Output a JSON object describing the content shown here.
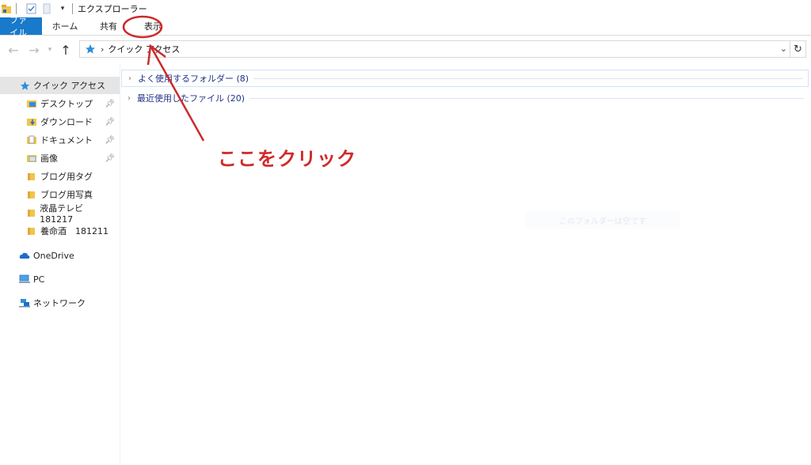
{
  "window": {
    "title": "エクスプローラー"
  },
  "ribbon": {
    "tabs": [
      "ファイル",
      "ホーム",
      "共有",
      "表示"
    ]
  },
  "address": {
    "path": "クイック アクセス",
    "icon": "star-icon"
  },
  "nav_pane": {
    "quick_access": "クイック アクセス",
    "items": [
      {
        "label": "デスクトップ",
        "icon": "desktop-folder-icon",
        "pinned": true
      },
      {
        "label": "ダウンロード",
        "icon": "download-folder-icon",
        "pinned": true
      },
      {
        "label": "ドキュメント",
        "icon": "document-folder-icon",
        "pinned": true
      },
      {
        "label": "画像",
        "icon": "pictures-folder-icon",
        "pinned": true
      },
      {
        "label": "ブログ用タグ",
        "icon": "folder-icon",
        "pinned": false
      },
      {
        "label": "ブログ用写真",
        "icon": "folder-icon",
        "pinned": false
      },
      {
        "label": "液晶テレビ　181217",
        "icon": "folder-icon",
        "pinned": false
      },
      {
        "label": "養命酒　181211",
        "icon": "folder-icon",
        "pinned": false
      }
    ],
    "onedrive": "OneDrive",
    "pc": "PC",
    "network": "ネットワーク"
  },
  "content": {
    "groups": [
      {
        "label": "よく使用するフォルダー (8)"
      },
      {
        "label": "最近使用したファイル (20)"
      }
    ],
    "empty_note": "このフォルダーは空です"
  },
  "annotation": {
    "text": "ここをクリック",
    "color": "#d02a2a"
  },
  "colors": {
    "file_tab": "#1979ca",
    "selected": "#e5e5e5",
    "group_text": "#1e3287"
  }
}
